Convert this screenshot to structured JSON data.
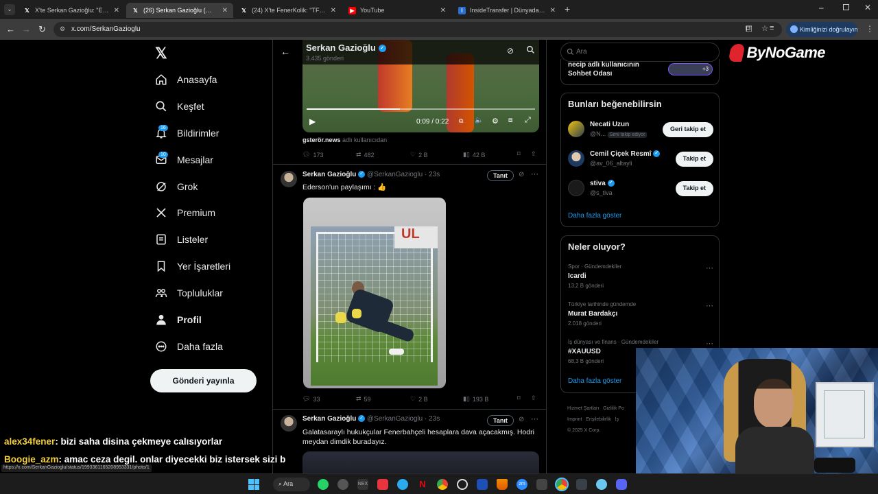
{
  "browser": {
    "tabs": [
      {
        "label": "X'te Serkan Gazioğlu: \"Ederson",
        "active": false
      },
      {
        "label": "(26) Serkan Gazioğlu (@Serkan",
        "active": true
      },
      {
        "label": "(24) X'te FenerKolik: \"TFF Tahkim",
        "active": false
      },
      {
        "label": "YouTube",
        "active": false
      },
      {
        "label": "InsideTransfer | Dünyadan Son",
        "active": false
      }
    ],
    "url": "x.com/SerkanGazioglu",
    "verify_label": "Kimliğinizi doğrulayın"
  },
  "nav": {
    "items": [
      {
        "label": "Anasayfa"
      },
      {
        "label": "Keşfet"
      },
      {
        "label": "Bildirimler",
        "badge": "16"
      },
      {
        "label": "Mesajlar",
        "badge": "10"
      },
      {
        "label": "Grok"
      },
      {
        "label": "Premium"
      },
      {
        "label": "Listeler"
      },
      {
        "label": "Yer İşaretleri"
      },
      {
        "label": "Topluluklar"
      },
      {
        "label": "Profil"
      },
      {
        "label": "Daha fazla"
      }
    ],
    "post_button": "Gönderi yayınla"
  },
  "timeline": {
    "header_name": "Serkan Gazioğlu",
    "header_count": "3.435 gönderi",
    "video_time": "0:09 / 0:22",
    "video_source": "gsterör.news",
    "video_source_suffix": "adlı kullanıcıdan",
    "tweet0_stats": {
      "replies": "173",
      "retweets": "482",
      "likes": "2 B",
      "views": "42 B"
    },
    "tweet1": {
      "name": "Serkan Gazioğlu",
      "handle": "@SerkanGazioglu",
      "time": "· 23s",
      "text": "Ederson'un paylaşımı : 👍",
      "tanit": "Tanıt",
      "stats": {
        "replies": "33",
        "retweets": "59",
        "likes": "2 B",
        "views": "193 B"
      }
    },
    "tweet2": {
      "name": "Serkan Gazioğlu",
      "handle": "@SerkanGazioglu",
      "time": "· 23s",
      "text": "Galatasaraylı hukukçular Fenerbahçeli hesaplara dava açacakmış. Hodri meydan dimdik buradayız.",
      "tanit": "Tanıt"
    }
  },
  "right": {
    "search_placeholder": "Ara",
    "space_title": "necip adlı kullanıcının Sohbet Odası",
    "space_more": "+3",
    "suggest_title": "Bunları beğenebilirsin",
    "suggestions": [
      {
        "name": "Necati Uzun",
        "handle": "@N...",
        "follows_you": "Seni takip ediyor",
        "button": "Geri takip et"
      },
      {
        "name": "Cemil Çiçek Resmî",
        "handle": "@av_06_altayli",
        "button": "Takip et"
      },
      {
        "name": "stiva",
        "handle": "@s_tiva",
        "button": "Takip et"
      }
    ],
    "show_more": "Daha fazla göster",
    "trends_title": "Neler oluyor?",
    "trends": [
      {
        "context": "Spor · Gündemdekiler",
        "title": "Icardi",
        "count": "13,2 B gönderi"
      },
      {
        "context": "Türkiye tarihinde gündemde",
        "title": "Murat Bardakçı",
        "count": "2.018 gönderi"
      },
      {
        "context": "İş dünyası ve finans · Gündemdekiler",
        "title": "#XAUUSD",
        "count": "68,3 B gönderi"
      }
    ],
    "trends_more": "Daha fazla göster",
    "footer": [
      "Hizmet Şartları",
      "Gizlilik Po",
      "Imprint",
      "Erişilebilirlik",
      "İş",
      "© 2025 X Corp."
    ]
  },
  "overlay": {
    "logo_text": "ByNoGame",
    "chat": [
      {
        "user": "alex34fener",
        "message": ": bizi saha disina çekmeye calısıyorlar"
      },
      {
        "user": "Boogie_azm",
        "message": ": amac ceza degil. onlar diyecekki biz istersek sizi b"
      }
    ],
    "status_url": "https://x.com/SerkanGazioglu/status/1993361165208953331/photo/1",
    "colors": {
      "user1": "#f4d03f",
      "user2": "#f4d03f"
    }
  },
  "taskbar": {
    "search_label": "Ara"
  }
}
